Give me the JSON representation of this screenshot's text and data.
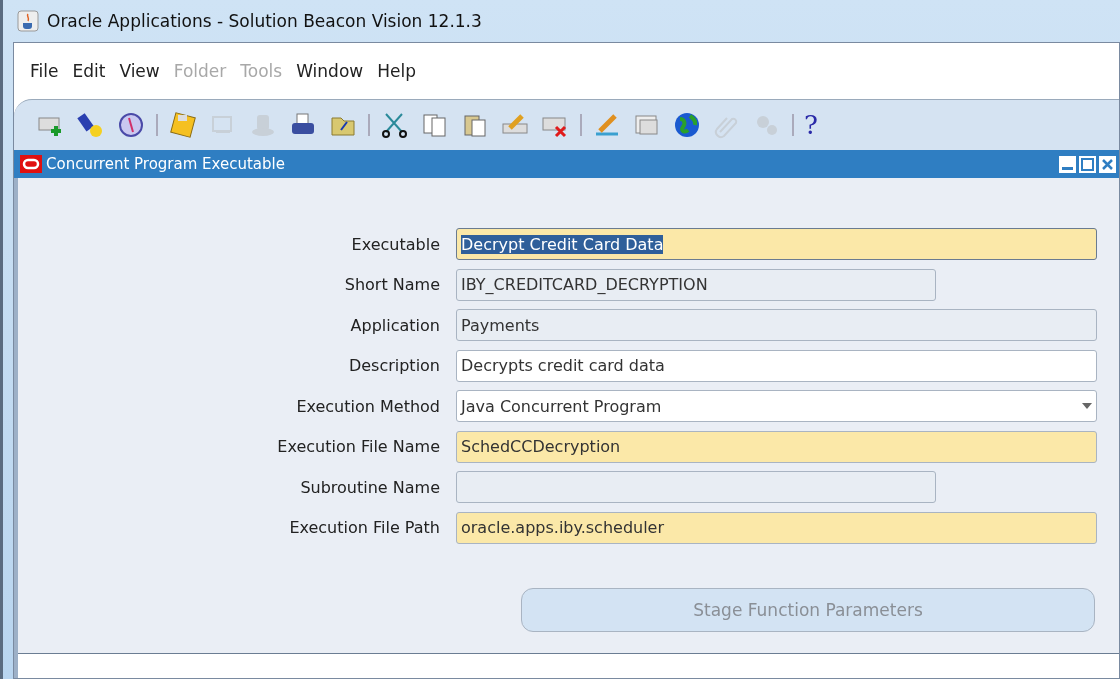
{
  "window": {
    "title": "Oracle Applications - Solution Beacon Vision 12.1.3"
  },
  "menu": [
    {
      "label": "File",
      "disabled": false
    },
    {
      "label": "Edit",
      "disabled": false
    },
    {
      "label": "View",
      "disabled": false
    },
    {
      "label": "Folder",
      "disabled": true
    },
    {
      "label": "Tools",
      "disabled": true
    },
    {
      "label": "Window",
      "disabled": false
    },
    {
      "label": "Help",
      "disabled": false
    }
  ],
  "toolbar": [
    {
      "kind": "new",
      "disabled": false
    },
    {
      "kind": "find",
      "disabled": false
    },
    {
      "kind": "navigator",
      "disabled": false
    },
    {
      "kind": "separator"
    },
    {
      "kind": "save",
      "disabled": false
    },
    {
      "kind": "next-step",
      "disabled": true
    },
    {
      "kind": "switch",
      "disabled": true
    },
    {
      "kind": "print",
      "disabled": false
    },
    {
      "kind": "close-form",
      "disabled": false
    },
    {
      "kind": "separator"
    },
    {
      "kind": "cut",
      "disabled": false
    },
    {
      "kind": "copy",
      "disabled": false
    },
    {
      "kind": "paste",
      "disabled": false
    },
    {
      "kind": "clear-record",
      "disabled": false
    },
    {
      "kind": "delete",
      "disabled": false
    },
    {
      "kind": "separator"
    },
    {
      "kind": "edit-field",
      "disabled": false
    },
    {
      "kind": "zoom",
      "disabled": false
    },
    {
      "kind": "translations",
      "disabled": false
    },
    {
      "kind": "attachments",
      "disabled": true
    },
    {
      "kind": "folder-tools",
      "disabled": true
    },
    {
      "kind": "separator"
    },
    {
      "kind": "help",
      "label": "?",
      "disabled": false
    }
  ],
  "form": {
    "title": "Concurrent Program Executable",
    "fields": [
      {
        "label": "Executable",
        "value": "Decrypt Credit Card Data",
        "kind": "required",
        "wide": true,
        "selected": true
      },
      {
        "label": "Short Name",
        "value": "IBY_CREDITCARD_DECRYPTION",
        "kind": "readonly",
        "wide": false,
        "selected": false
      },
      {
        "label": "Application",
        "value": "Payments",
        "kind": "readonly",
        "wide": true,
        "selected": false
      },
      {
        "label": "Description",
        "value": "Decrypts credit card data",
        "kind": "normal",
        "wide": true,
        "selected": false
      },
      {
        "label": "Execution Method",
        "value": "Java Concurrent Program",
        "kind": "select",
        "wide": true,
        "selected": false
      },
      {
        "label": "Execution File Name",
        "value": "SchedCCDecryption",
        "kind": "required",
        "wide": true,
        "selected": false
      },
      {
        "label": "Subroutine Name",
        "kind": "readonly",
        "wide": false,
        "selected": false
      },
      {
        "label": "Execution File Path",
        "value": "oracle.apps.iby.scheduler",
        "kind": "required",
        "wide": true,
        "selected": false
      }
    ],
    "button": {
      "label": "Stage Function Parameters",
      "disabled": true
    }
  }
}
